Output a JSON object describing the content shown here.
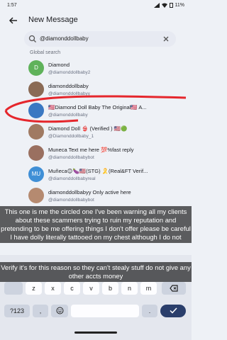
{
  "status_bar": {
    "time": "1:57",
    "icons": [
      "silent-icon",
      "signal-icon",
      "wifi-icon"
    ],
    "battery": "11%"
  },
  "header": {
    "title": "New Message"
  },
  "search": {
    "value": "@diamonddollbaby"
  },
  "section_label": "Global search",
  "results": [
    {
      "avatar_type": "letter",
      "avatar_text": "D",
      "avatar_color": "#5fb25a",
      "name": "Diamond",
      "handle": "@diamonddollbaby2"
    },
    {
      "avatar_type": "photo",
      "avatar_text": "",
      "avatar_color": "#8a6a55",
      "name": "diamonddollbaby",
      "handle": "@diamonddollbabyy"
    },
    {
      "avatar_type": "photo",
      "avatar_text": "",
      "avatar_color": "#3a78c2",
      "name": "🇱🇷Diamond Doll Baby The Original🇱🇷 A...",
      "handle": "@diamonddollbaby"
    },
    {
      "avatar_type": "photo",
      "avatar_text": "",
      "avatar_color": "#a07a62",
      "name": "Diamond Doll 👙 (Verified ) 🇺🇸🟢",
      "handle": "@Diamonddollbaby_1"
    },
    {
      "avatar_type": "photo",
      "avatar_text": "",
      "avatar_color": "#9a7060",
      "name": "Muneca Text me here 💯%fast reply",
      "handle": "@diamonddollbabybot"
    },
    {
      "avatar_type": "letter",
      "avatar_text": "MU",
      "avatar_color": "#3f8fd6",
      "name": "Muñeca😊🍆🇺🇸(STG) 🎗️(Real&FT Verif...",
      "handle": "@diamonddollbabyreal"
    },
    {
      "avatar_type": "photo",
      "avatar_text": "",
      "avatar_color": "#b58a70",
      "name": "diamonddollbabyy Only active here",
      "handle": "@diamonddollbabybot"
    }
  ],
  "captions": [
    "This one is me the circled one I've been warning all my clients about these scammers trying to ruin my reputation and pretending to be me offering things I don't offer please be careful I have dolly literally tattooed on my chest although I do not",
    "Verify it's for this reason so they can't stealy stuff do not give any other accts money"
  ],
  "keyboard": {
    "row3": [
      "z",
      "x",
      "c",
      "v",
      "b",
      "n",
      "m"
    ],
    "backspace_icon": "backspace-icon",
    "bottom_left": "?123",
    "comma": ",",
    "emoji_icon": "emoji-icon",
    "period": ".",
    "enter_icon": "check-icon"
  },
  "colors": {
    "accent": "#3a78c2",
    "annotation_red": "#e5262c"
  }
}
